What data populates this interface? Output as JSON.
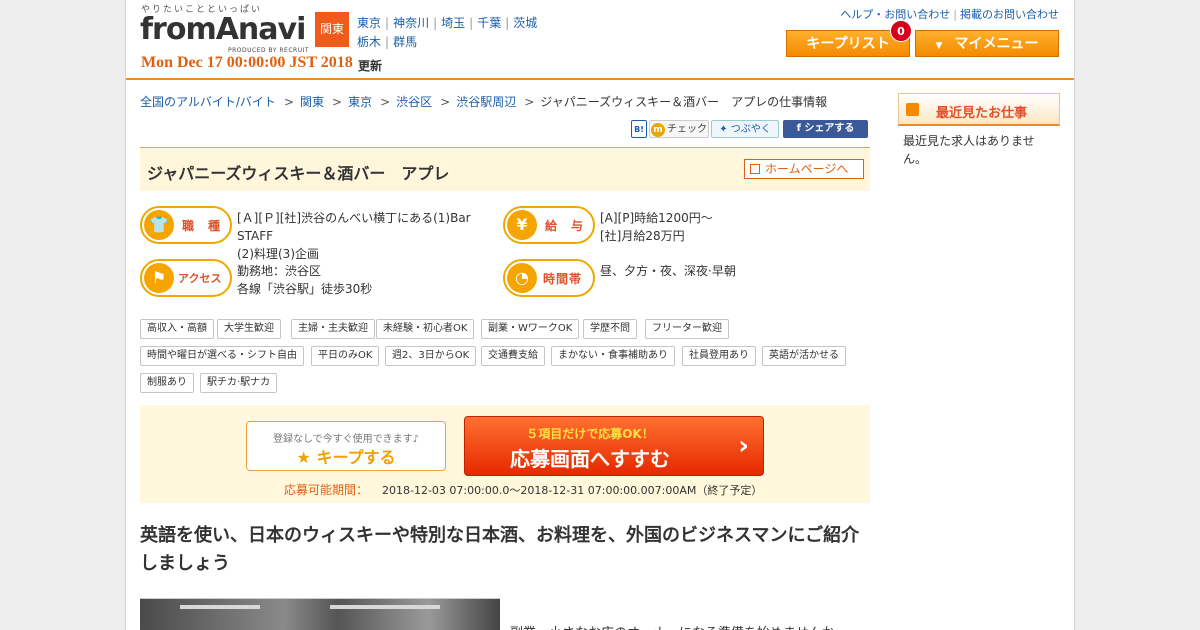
{
  "header": {
    "tagline": "やりたいことといっぱい",
    "logo": "fromAnavi",
    "logo_sub": "PRODUCED BY RECRUIT",
    "region": "関東",
    "prefectures": [
      "東京",
      "神奈川",
      "埼玉",
      "千葉",
      "茨城",
      "栃木",
      "群馬"
    ],
    "datetime": "Mon Dec 17 00:00:00 JST 2018",
    "updated_label": "更新",
    "help_link": "ヘルプ・お問い合わせ",
    "listing_inquiry_link": "掲載のお問い合わせ",
    "keep_list_label": "キープリスト",
    "keep_count": "0",
    "my_menu_label": "マイメニュー"
  },
  "breadcrumb": {
    "items": [
      "全国のアルバイト/バイト",
      "関東",
      "東京",
      "渋谷区",
      "渋谷駅周辺"
    ],
    "current": "ジャパニーズウィスキー＆酒バー　アプレの仕事情報"
  },
  "social": {
    "hatena": "B!",
    "mixi": "チェック",
    "twitter": "つぶやく",
    "facebook": "シェアする"
  },
  "job": {
    "title": "ジャパニーズウィスキー＆酒バー　アプレ",
    "homepage_label": "ホームページへ",
    "occupation_label": "職　種",
    "occupation_lines": [
      "[Ａ][Ｐ][社]渋谷のんべい横丁にある(1)Bar STAFF",
      "(2)料理(3)企画"
    ],
    "salary_label": "給　与",
    "salary_lines": [
      "[A][P]時給1200円～",
      "[社]月給28万円"
    ],
    "access_label": "アクセス",
    "access_lines": [
      "勤務地：渋谷区",
      "各線「渋谷駅」徒歩30秒"
    ],
    "hours_label": "時間帯",
    "hours_lines": [
      "昼、夕方・夜、深夜·早朝"
    ]
  },
  "tags": [
    "高収入・高額",
    "大学生歓迎",
    "主婦・主夫歓迎",
    "未経験・初心者OK",
    "副業・WワークOK",
    "学歴不問",
    "フリーター歓迎",
    "時間や曜日が選べる・シフト自由",
    "平日のみOK",
    "週2、3日からOK",
    "交通費支給",
    "まかない・食事補助あり",
    "社員登用あり",
    "英語が活かせる",
    "制服あり",
    "駅チカ·駅ナカ"
  ],
  "cta": {
    "keep_note": "登録なしで今すぐ使用できます♪",
    "keep_label": "キープする",
    "apply_note": "５項目だけで応募OK！",
    "apply_label": "応募画面へすすむ",
    "period_label": "応募可能期間：",
    "period_value": "2018-12-03 07:00:00.0～2018-12-31 07:00:00.007:00AM（終了予定）"
  },
  "headline": "英語を使い、日本のウィスキーや特別な日本酒、お料理を、外国のビジネスマンにご紹介しましょう",
  "body_snippet": "副業、小さなお店のオーナーになる準備を始めませんか",
  "sidebar": {
    "recent_title": "最近見たお仕事",
    "recent_empty": "最近見た求人はありません。"
  }
}
